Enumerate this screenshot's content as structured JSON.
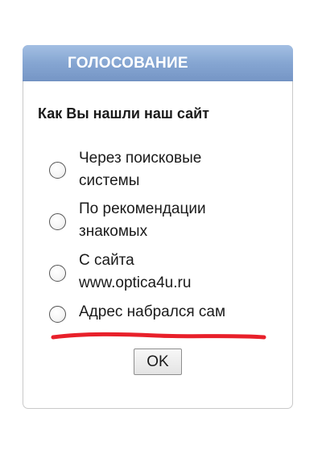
{
  "poll": {
    "title": "ГОЛОСОВАНИЕ",
    "question": "Как Вы нашли наш сайт",
    "options": [
      {
        "line1": "Через поисковые",
        "line2": "системы",
        "selected": false
      },
      {
        "line1": "По рекомендации",
        "line2": "знакомых",
        "selected": false
      },
      {
        "line1": "С сайта",
        "line2": "www.optica4u.ru",
        "selected": false
      },
      {
        "line1": "Адрес набрался сам",
        "line2": "",
        "selected": false
      }
    ],
    "submit_label": "OK"
  },
  "colors": {
    "header_gradient_top": "#a3bfe3",
    "header_gradient_bottom": "#7696c6",
    "underline_annotation": "#e8202a"
  }
}
